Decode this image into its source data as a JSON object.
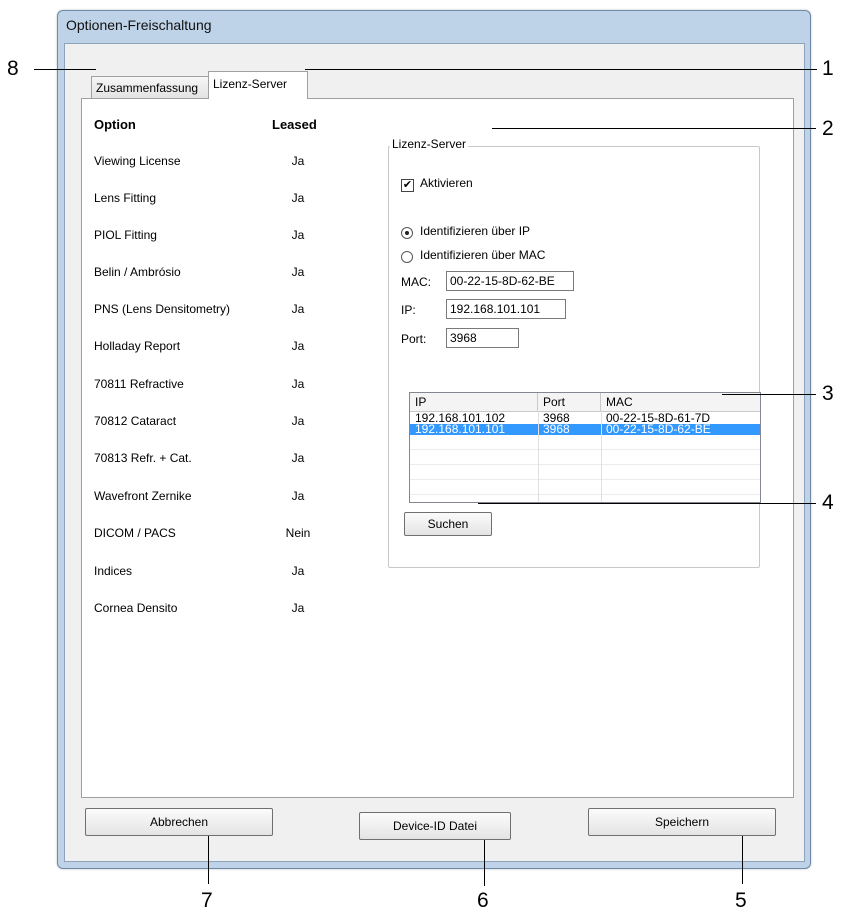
{
  "window": {
    "title": "Optionen-Freischaltung"
  },
  "tabs": [
    {
      "label": "Zusammenfassung",
      "active": false
    },
    {
      "label": "Lizenz-Server",
      "active": true
    }
  ],
  "options": {
    "header_option": "Option",
    "header_leased": "Leased",
    "rows": [
      {
        "name": "Viewing License",
        "leased": "Ja"
      },
      {
        "name": "Lens Fitting",
        "leased": "Ja"
      },
      {
        "name": "PIOL Fitting",
        "leased": "Ja"
      },
      {
        "name": "Belin / Ambrósio",
        "leased": "Ja"
      },
      {
        "name": "PNS (Lens Densitometry)",
        "leased": "Ja"
      },
      {
        "name": "Holladay Report",
        "leased": "Ja"
      },
      {
        "name": "70811 Refractive",
        "leased": "Ja"
      },
      {
        "name": "70812 Cataract",
        "leased": "Ja"
      },
      {
        "name": "70813  Refr. + Cat.",
        "leased": "Ja"
      },
      {
        "name": "Wavefront Zernike",
        "leased": "Ja"
      },
      {
        "name": "DICOM / PACS",
        "leased": "Nein"
      },
      {
        "name": "Indices",
        "leased": "Ja"
      },
      {
        "name": "Cornea Densito",
        "leased": "Ja"
      }
    ]
  },
  "server": {
    "group_label": "Lizenz-Server",
    "activate_label": "Aktivieren",
    "activate_checked": true,
    "radio_ip_label": "Identifizieren über IP",
    "radio_mac_label": "Identifizieren über MAC",
    "radio_selected": "ip",
    "mac_label": "MAC:",
    "mac_value": "00-22-15-8D-62-BE",
    "ip_label": "IP:",
    "ip_value": "192.168.101.101",
    "port_label": "Port:",
    "port_value": "3968",
    "table_headers": [
      "IP",
      "Port",
      "MAC"
    ],
    "table_rows": [
      {
        "ip": "192.168.101.102",
        "port": "3968",
        "mac": "00-22-15-8D-61-7D",
        "selected": false
      },
      {
        "ip": "192.168.101.101",
        "port": "3968",
        "mac": "00-22-15-8D-62-BE",
        "selected": true
      }
    ],
    "search_button": "Suchen"
  },
  "buttons": {
    "cancel": "Abbrechen",
    "device_id": "Device-ID Datei",
    "save": "Speichern"
  },
  "callouts": [
    "1",
    "2",
    "3",
    "4",
    "5",
    "6",
    "7",
    "8"
  ],
  "colors": {
    "selection": "#3399ff",
    "window_frame": "#bed3e8"
  }
}
